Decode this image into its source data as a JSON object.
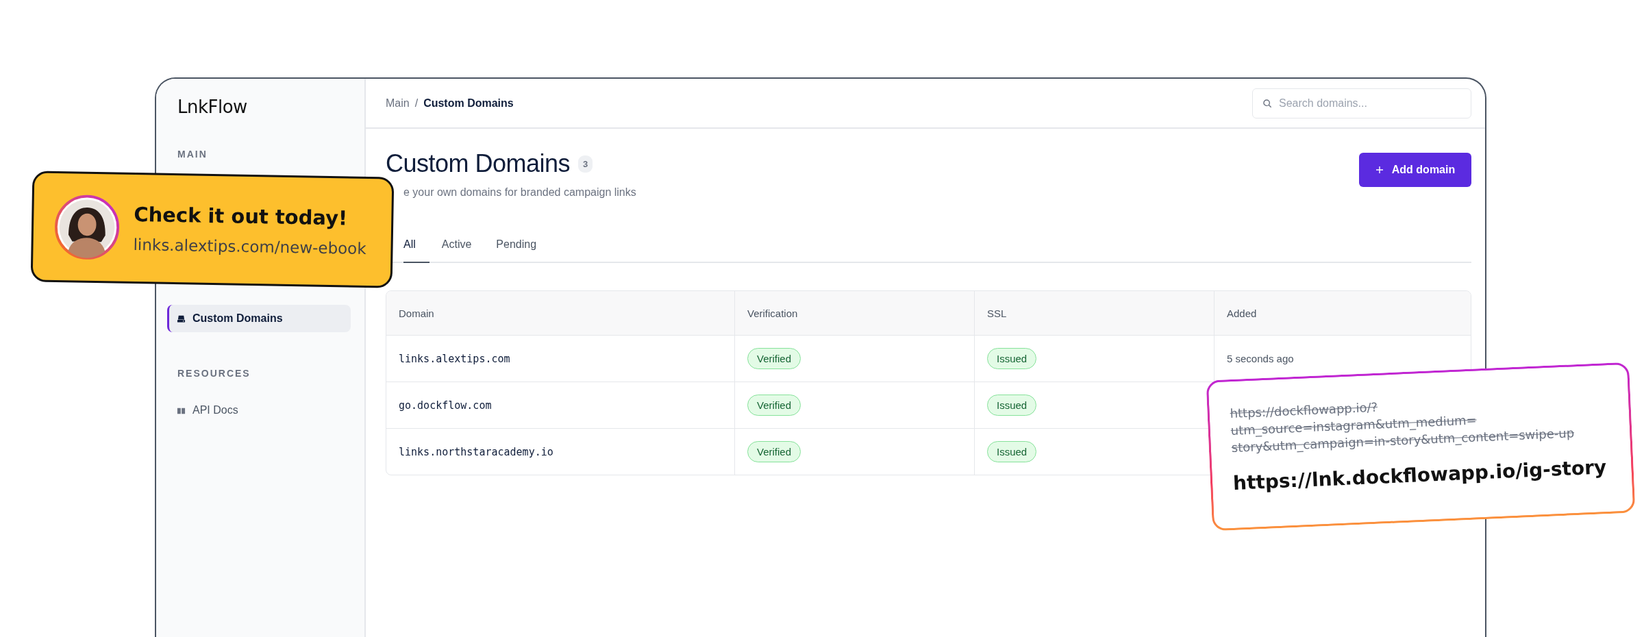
{
  "logo": "LnkFlow",
  "sidebar": {
    "sections": [
      {
        "title": "MAIN",
        "items": [
          {
            "label": "Custom Domains",
            "selected": true
          }
        ]
      },
      {
        "title": "RESOURCES",
        "items": [
          {
            "label": "API Docs",
            "selected": false
          }
        ]
      }
    ]
  },
  "breadcrumb": {
    "separator": "/",
    "items": [
      {
        "label": "Main",
        "current": false
      },
      {
        "label": "Custom Domains",
        "current": true
      }
    ]
  },
  "search": {
    "placeholder": "Search domains..."
  },
  "page": {
    "title": "Custom Domains",
    "count": "3",
    "subtitle": "e your own domains for branded campaign links",
    "add_button": "Add domain"
  },
  "tabs": [
    {
      "label": "All",
      "selected": true
    },
    {
      "label": "Active",
      "selected": false
    },
    {
      "label": "Pending",
      "selected": false
    }
  ],
  "table": {
    "columns": [
      "Domain",
      "Verification",
      "SSL",
      "Added"
    ],
    "rows": [
      {
        "domain": "links.alextips.com",
        "verification": "Verified",
        "ssl": "Issued",
        "added": "5 seconds ago"
      },
      {
        "domain": "go.dockflow.com",
        "verification": "Verified",
        "ssl": "Issued"
      },
      {
        "domain": "links.northstaracademy.io",
        "verification": "Verified",
        "ssl": "Issued"
      }
    ]
  },
  "promo_card": {
    "title": "Check it out today!",
    "url": "links.alextips.com/new-ebook"
  },
  "link_card": {
    "long_url_lines": [
      "https://dockflowapp.io/?",
      "utm_source=instagram&utm_medium=",
      "story&utm_campaign=in-story&utm_content=swipe-up"
    ],
    "short_url": "https://lnk.dockflowapp.io/ig-story"
  }
}
